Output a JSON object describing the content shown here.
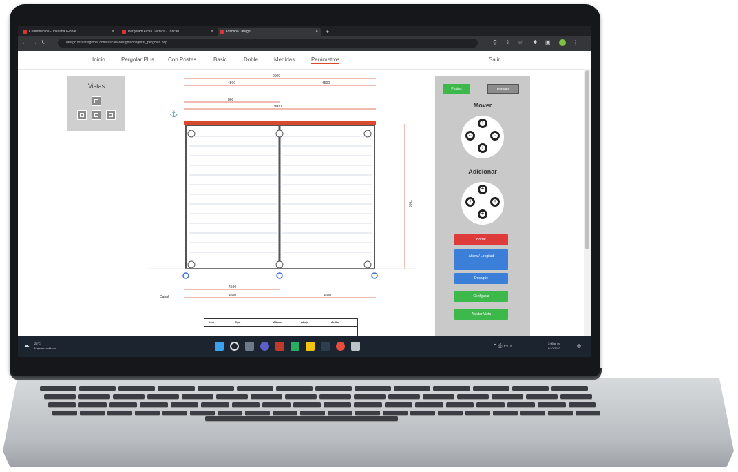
{
  "browser": {
    "tabs": [
      {
        "label": "Cubrimientos - Toscana Global"
      },
      {
        "label": "Pergolam Ficha Técnica - Toscan"
      },
      {
        "label": "Toscana Design"
      }
    ],
    "url": "design.toscanaglobal.com/toscanadesign/configurar_pergolab.php"
  },
  "site_nav": {
    "items": [
      "Inicio",
      "Pergolar Plus",
      "Con Postes",
      "Basic",
      "Doble",
      "Medidas",
      "Parámetros"
    ],
    "active": "Parámetros",
    "exit": "Salir"
  },
  "vistas": {
    "title": "Vistas"
  },
  "drawing": {
    "dim_total": "9000",
    "dim_left": "4500",
    "dim_right": "4500",
    "dim_small": "800",
    "dim_overall": "9000",
    "dim_height": "7000",
    "bottom_dim1": "4500",
    "bottom_dim2": "4500",
    "bottom_dim3": "4500",
    "canal_label": "Canal"
  },
  "table": {
    "headers": [
      "Item",
      "Tipo",
      "Altura",
      "Abaje",
      "Arriba"
    ]
  },
  "panel": {
    "mode_on": "Postes",
    "mode_off": "Paredes",
    "mover": "Mover",
    "adicionar": "Adicionar",
    "borrar": "Borrar",
    "altura": "Altura / Longitud",
    "girar": "Desagüe",
    "configurar": "Configurar",
    "guardar": "Ajustar Vista"
  },
  "taskbar": {
    "weather_temp": "25°C",
    "weather_desc": "Mayorm. nublado",
    "time": "3:05 p. m.",
    "date": "6/10/2022"
  },
  "colors": {
    "accent_orange": "#d84a2d",
    "green": "#3db84a",
    "red": "#e03b3b",
    "blue": "#3c7fd8"
  }
}
